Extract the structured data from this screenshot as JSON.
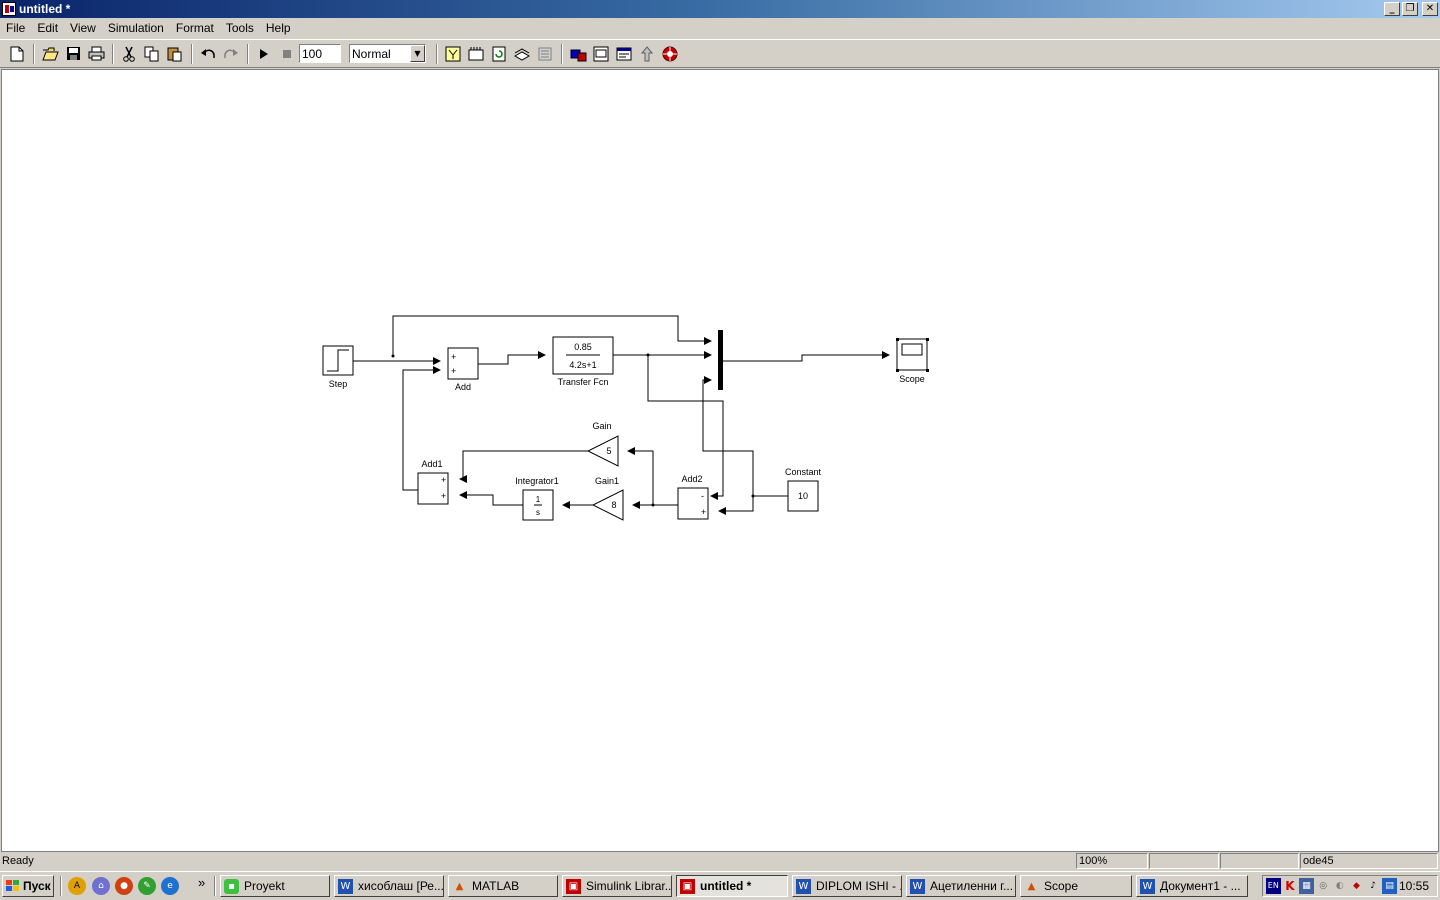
{
  "window": {
    "title": "untitled *",
    "minimize_glyph": "_",
    "maximize_glyph": "❐",
    "close_glyph": "✕"
  },
  "menu": [
    "File",
    "Edit",
    "View",
    "Simulation",
    "Format",
    "Tools",
    "Help"
  ],
  "toolbar": {
    "stop_time": "100",
    "sim_mode": "Normal",
    "icons": [
      "new-model-icon",
      "open-icon",
      "save-icon",
      "print-icon",
      "cut-icon",
      "copy-icon",
      "paste-icon",
      "undo-icon",
      "redo-icon",
      "start-simulation-icon",
      "stop-simulation-icon",
      "build-icon",
      "update-diagram-icon",
      "refresh-icon",
      "library-browser-icon",
      "model-explorer-icon",
      "debugger-icon",
      "go-to-parent-icon",
      "help-icon"
    ]
  },
  "diagram": {
    "blocks": {
      "step": "Step",
      "add": "Add",
      "transfer_fcn": "Transfer Fcn",
      "tf_numerator": "0.85",
      "tf_denominator": "4.2s+1",
      "scope": "Scope",
      "gain": "Gain",
      "gain_value": "5",
      "gain1": "Gain1",
      "gain1_value": "8",
      "integrator1": "Integrator1",
      "integrator_num": "1",
      "integrator_den": "s",
      "add1": "Add1",
      "add2": "Add2",
      "constant": "Constant",
      "constant_value": "10",
      "plus": "+",
      "minus": "-"
    }
  },
  "status": {
    "state": "Ready",
    "zoom": "100%",
    "solver": "ode45"
  },
  "taskbar": {
    "start": "Пуск",
    "more": "»",
    "tasks": [
      {
        "label": "Proyekt",
        "icon": "folder-icon"
      },
      {
        "label": "хисоблаш [Ре...",
        "icon": "word-icon"
      },
      {
        "label": "MATLAB",
        "icon": "matlab-icon"
      },
      {
        "label": "Simulink Librar...",
        "icon": "simulink-icon"
      },
      {
        "label": "untitled *",
        "icon": "simulink-model-icon",
        "active": true
      },
      {
        "label": "DIPLOM ISHI - ...",
        "icon": "word-icon"
      },
      {
        "label": "Ацетиленни г...",
        "icon": "word-icon"
      },
      {
        "label": "Scope",
        "icon": "matlab-icon"
      },
      {
        "label": "Документ1 - ...",
        "icon": "word-icon"
      }
    ],
    "tray": {
      "lang": "EN",
      "clock": "10:55"
    }
  },
  "colors": {
    "title_gradient_start": "#0a246a",
    "title_gradient_end": "#a6caf0",
    "chrome": "#d4d0c8",
    "canvas": "#ffffff"
  }
}
